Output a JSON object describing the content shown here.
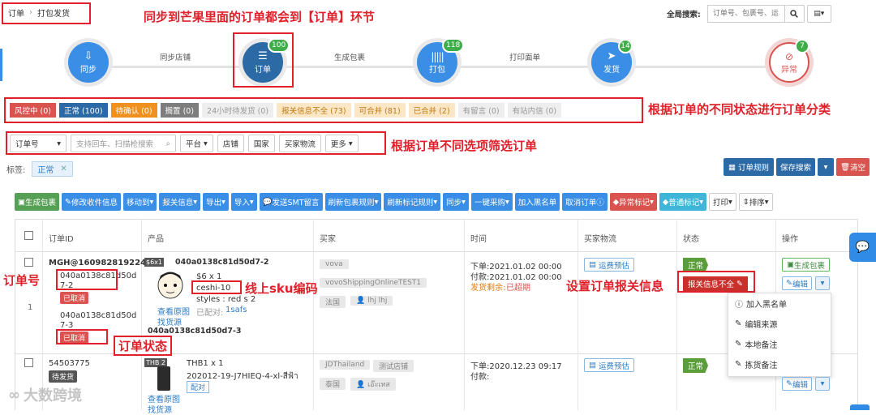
{
  "breadcrumb": {
    "root": "订单",
    "sep": "›",
    "current": "打包发货"
  },
  "global_search": {
    "label": "全局搜索:",
    "placeholder": "订单号、包裹号、运单号"
  },
  "steps": [
    {
      "label": "同步",
      "badge": ""
    },
    {
      "label": "订单",
      "badge": "100"
    },
    {
      "label": "打包",
      "badge": "118"
    },
    {
      "label": "发货",
      "badge": "14"
    },
    {
      "label": "异常",
      "badge": "7"
    }
  ],
  "step_links": [
    "同步店铺",
    "生成包裹",
    "打印面单"
  ],
  "status_tabs": [
    "风控中 (0)",
    "正常 (100)",
    "待确认 (0)",
    "搁置 (0)",
    "24小时待发货 (0)",
    "报关信息不全 (73)",
    "可合并 (81)",
    "已合并 (2)",
    "有留言 (0)",
    "有站内信 (0)"
  ],
  "filters": {
    "order_no": "订单号",
    "search_placeholder": "支持回车、扫描枪搜索",
    "platform": "平台",
    "shop": "店铺",
    "country": "国家",
    "logistics": "买家物流",
    "more": "更多"
  },
  "tag_row": {
    "label": "标签:",
    "value": "正常"
  },
  "right_actions": {
    "rules": "订单规则",
    "save_search": "保存搜索",
    "clear": "清空"
  },
  "actions": [
    "生成包裹",
    "修改收件信息",
    "移动到",
    "报关信息",
    "导出",
    "导入",
    "发送SMT留言",
    "刷新包裹规则",
    "刷新标记规则",
    "同步",
    "一键采购",
    "加入黑名单",
    "取消订单",
    "异常标记",
    "普通标记"
  ],
  "actions_right": [
    "打印",
    "排序"
  ],
  "table_headers": [
    "订单ID",
    "产品",
    "买家",
    "时间",
    "买家物流",
    "状态",
    "操作"
  ],
  "row1": {
    "index": "1",
    "order_id": "MGH@1609828192243",
    "sub1": "040a0138c81d50d7-2",
    "sub1_status": "已取消",
    "sub2": "040a0138c81d50d7-3",
    "sub2_status": "已取消",
    "prod_code": "040a0138c81d50d7-2",
    "thumb_label": "$6x1",
    "price": "$6 x 1",
    "sku": "ceshi-10",
    "styles": "styles : red s 2",
    "matched_label": "已配对:",
    "matched_val": "1safs",
    "view_img": "查看原图",
    "find_src": "找货源",
    "prod_code2": "040a0138c81d50d7-3",
    "buyer": "vova",
    "shop": "vovoShippingOnlineTEST1",
    "country": "法国",
    "buyer_name": "lhj lhj",
    "order_time": "下单:2021.01.02 00:00",
    "pay_time": "付款:2021.01.02 00:00",
    "ship_left_label": "发货剩余:",
    "ship_left": "已超期",
    "freight": "运费预估",
    "status": "正常",
    "customs": "报关信息不全",
    "op_pack": "生成包裹",
    "op_edit": "编辑"
  },
  "row2": {
    "order_id": "54503775",
    "status_tag": "待发货",
    "thumb_label": "THB 2",
    "title": "THB1 x 1",
    "sku": "202012-19-J7HIEQ-4-xl-สีฟ้า",
    "match": "配对",
    "view_img": "查看原图",
    "find_src": "找货源",
    "buyer": "JDThailand",
    "shop": "测试店铺",
    "country": "泰国",
    "buyer_name": "เอ๊ะเทส",
    "order_time": "下单:2020.12.23 09:17",
    "pay_time": "付款:",
    "freight": "运费预估",
    "status": "正常",
    "op_edit": "编辑"
  },
  "dropdown": [
    "加入黑名单",
    "编辑来源",
    "本地备注",
    "拣货备注"
  ],
  "annotations": {
    "top": "同步到芒果里面的订单都会到【订单】环节",
    "tabs": "根据订单的不同状态进行订单分类",
    "filters": "根据订单不同选项筛选订单",
    "order_no": "订单号",
    "sku": "线上sku编码",
    "customs": "设置订单报关信息",
    "order_status": "订单状态"
  },
  "watermark": "大数跨境"
}
